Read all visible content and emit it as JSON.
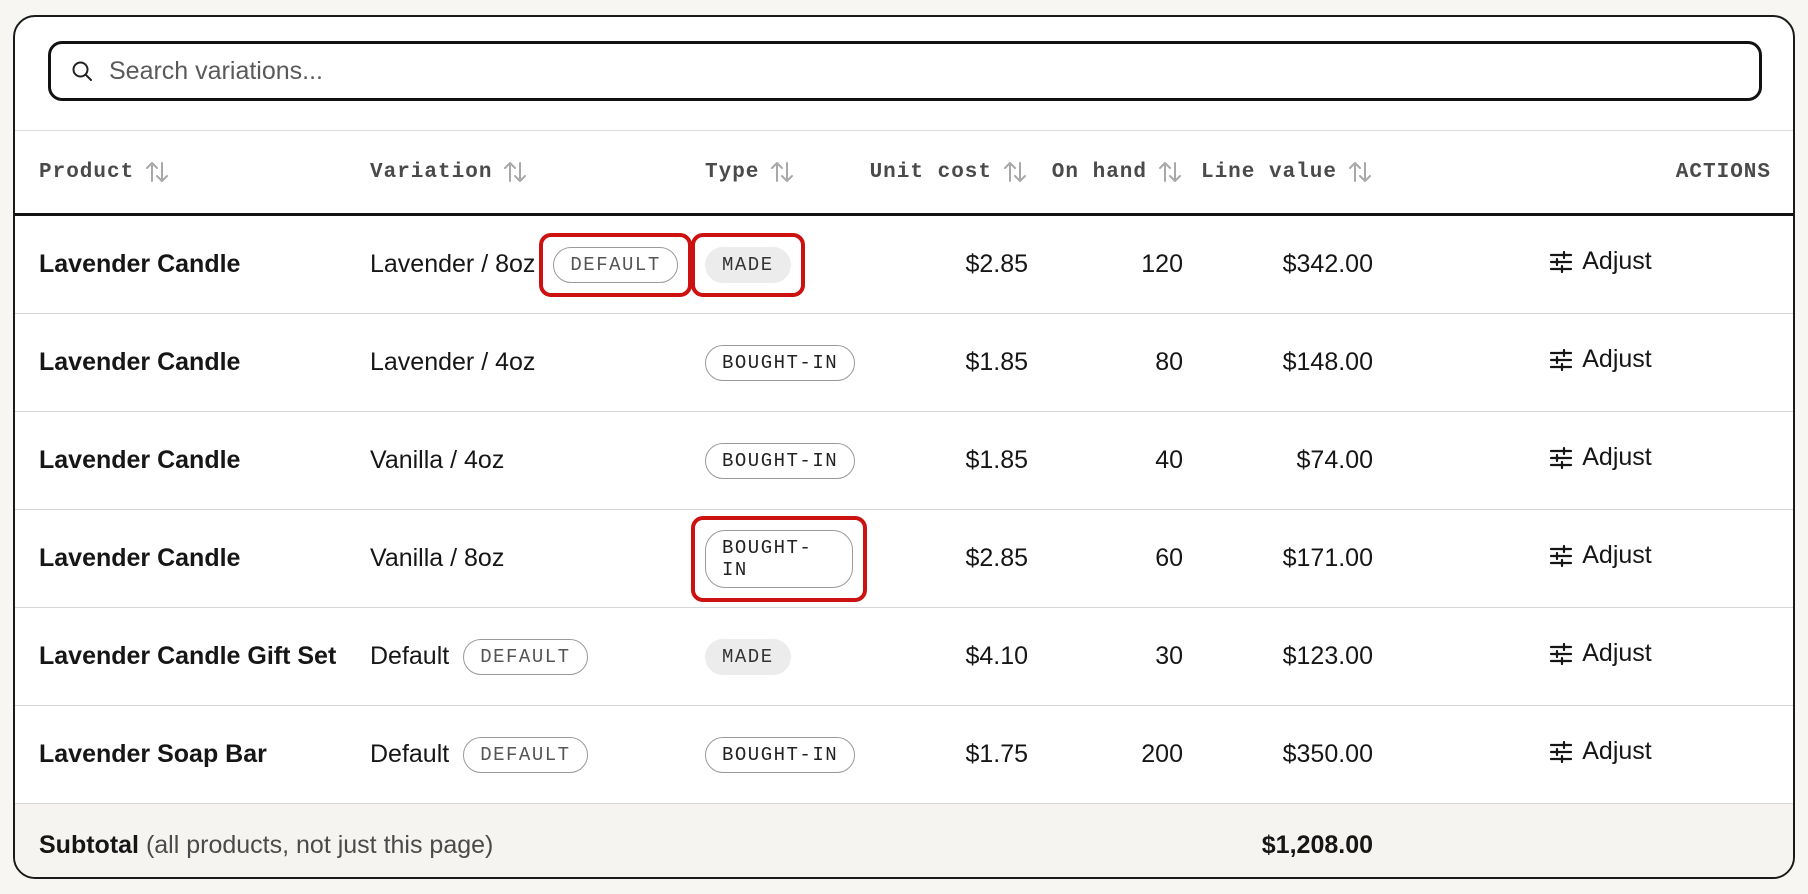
{
  "search": {
    "placeholder": "Search variations..."
  },
  "columns": {
    "product": "Product",
    "variation": "Variation",
    "type": "Type",
    "unit_cost": "Unit cost",
    "on_hand": "On hand",
    "line_value": "Line value",
    "actions": "ACTIONS"
  },
  "rows": [
    {
      "product": "Lavender Candle",
      "variation": "Lavender / 8oz",
      "default_badge": "DEFAULT",
      "type": "MADE",
      "unit_cost": "$2.85",
      "on_hand": "120",
      "line_value": "$342.00",
      "action": "Adjust"
    },
    {
      "product": "Lavender Candle",
      "variation": "Lavender / 4oz",
      "default_badge": "",
      "type": "BOUGHT-IN",
      "unit_cost": "$1.85",
      "on_hand": "80",
      "line_value": "$148.00",
      "action": "Adjust"
    },
    {
      "product": "Lavender Candle",
      "variation": "Vanilla / 4oz",
      "default_badge": "",
      "type": "BOUGHT-IN",
      "unit_cost": "$1.85",
      "on_hand": "40",
      "line_value": "$74.00",
      "action": "Adjust"
    },
    {
      "product": "Lavender Candle",
      "variation": "Vanilla / 8oz",
      "default_badge": "",
      "type": "BOUGHT-IN",
      "unit_cost": "$2.85",
      "on_hand": "60",
      "line_value": "$171.00",
      "action": "Adjust"
    },
    {
      "product": "Lavender Candle Gift Set",
      "variation": "Default",
      "default_badge": "DEFAULT",
      "type": "MADE",
      "unit_cost": "$4.10",
      "on_hand": "30",
      "line_value": "$123.00",
      "action": "Adjust"
    },
    {
      "product": "Lavender Soap Bar",
      "variation": "Default",
      "default_badge": "DEFAULT",
      "type": "BOUGHT-IN",
      "unit_cost": "$1.75",
      "on_hand": "200",
      "line_value": "$350.00",
      "action": "Adjust"
    }
  ],
  "subtotal": {
    "label": "Subtotal",
    "note": "(all products, not just this page)",
    "value": "$1,208.00"
  },
  "colors": {
    "highlight": "#cc1111",
    "border": "#121212",
    "footer_bg": "#f5f4f1"
  },
  "icons": {
    "search": "search-icon",
    "sort": "sort-arrows-icon",
    "adjust": "sliders-icon"
  }
}
